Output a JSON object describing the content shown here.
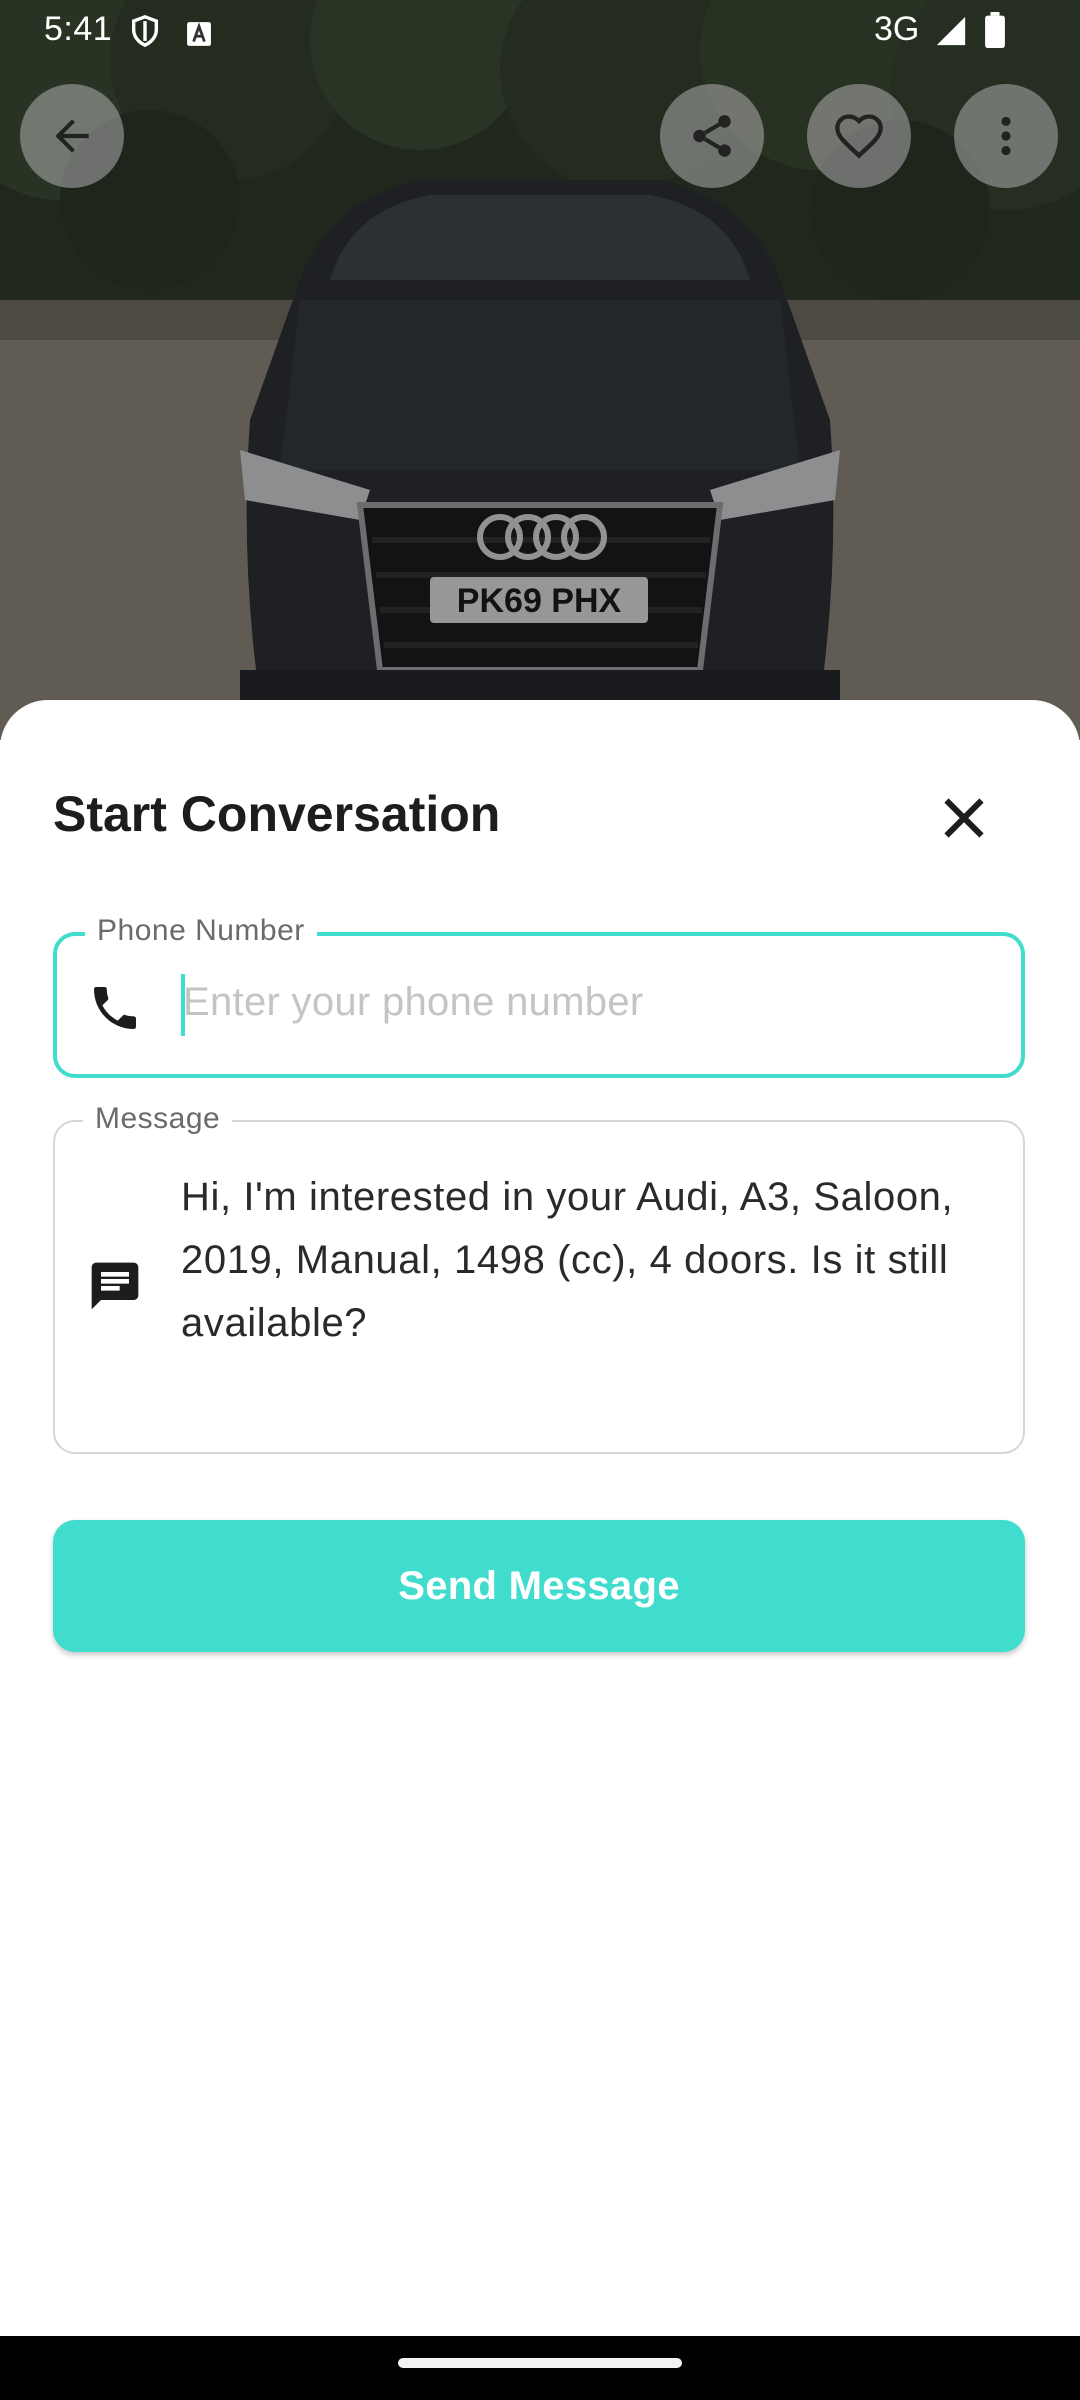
{
  "status_bar": {
    "time": "5:41",
    "network": "3G",
    "icons": [
      "shield-icon",
      "font-a-icon",
      "signal-icon",
      "battery-icon"
    ]
  },
  "top_bar": {
    "icons": [
      "back-arrow-icon",
      "share-icon",
      "heart-icon",
      "more-vert-icon"
    ]
  },
  "photo": {
    "plate": "PK69 PHX"
  },
  "sheet": {
    "title": "Start Conversation",
    "phone_field": {
      "label": "Phone Number",
      "placeholder": "Enter your phone number",
      "value": "",
      "icon": "phone-icon"
    },
    "message_field": {
      "label": "Message",
      "value": "Hi, I'm interested in your Audi, A3, Saloon, 2019, Manual, 1498 (cc), 4 doors. Is it still available?",
      "icon": "message-icon"
    },
    "send_label": "Send Message"
  },
  "colors": {
    "accent": "#40ddcf",
    "title": "#1d1d1d",
    "placeholder": "#c4c4c4",
    "border": "#d6d6d6"
  }
}
